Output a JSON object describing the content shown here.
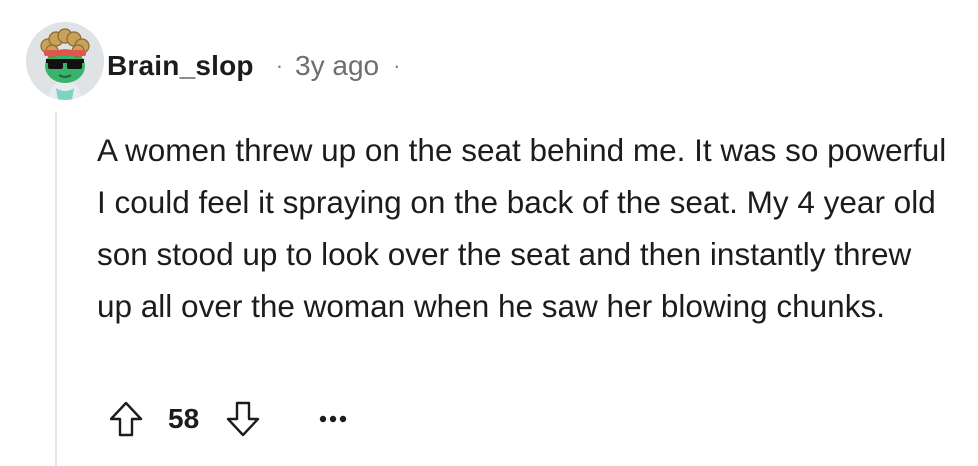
{
  "comment": {
    "author": "Brain_slop",
    "separator": "·",
    "age": "3y ago",
    "body": "A women threw up on the seat behind me. It was so powerful I could feel it spraying on the back of the seat. My 4 year old son stood up to look over the seat and then instantly threw up all over the woman when he saw her blowing chunks.",
    "score": "58"
  },
  "icons": {
    "avatar": "snoo-avatar-with-sunglasses-and-bandana",
    "upvote": "upvote-arrow-icon",
    "downvote": "downvote-arrow-icon",
    "more": "ellipsis-icon"
  },
  "colors": {
    "text": "#1c1c1c",
    "meta": "#6b6f72",
    "thread_line": "#e4e6e8",
    "avatar_skin": "#39b36b",
    "avatar_hair": "#c8a15a"
  }
}
